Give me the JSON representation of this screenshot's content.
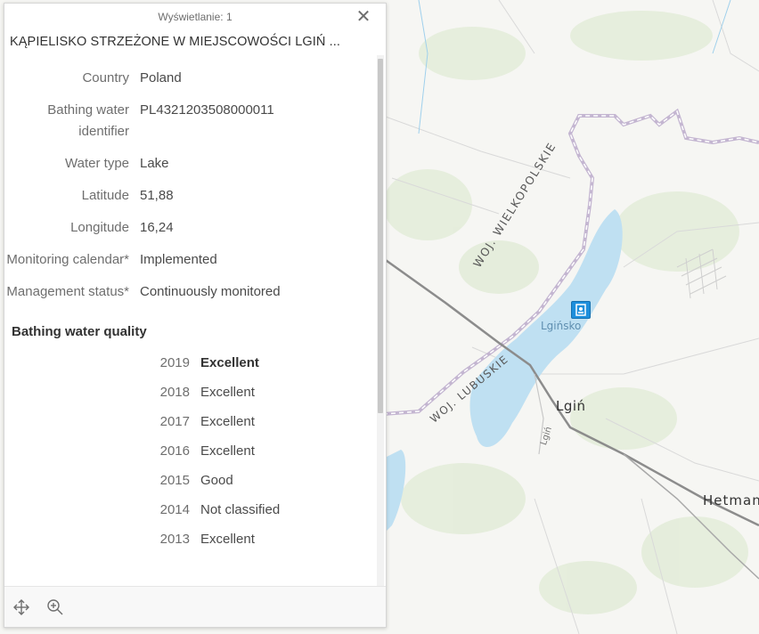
{
  "popup": {
    "header": "Wyświetlanie: 1",
    "title": "KĄPIELISKO STRZEŻONE W MIEJSCOWOŚCI LGIŃ ...",
    "attributes": [
      {
        "label": "Country",
        "value": "Poland"
      },
      {
        "label": "Bathing water identifier",
        "value": "PL4321203508000011"
      },
      {
        "label": "Water type",
        "value": "Lake"
      },
      {
        "label": "Latitude",
        "value": "51,88"
      },
      {
        "label": "Longitude",
        "value": "16,24"
      },
      {
        "label": "Monitoring calendar*",
        "value": "Implemented"
      },
      {
        "label": "Management status*",
        "value": "Continuously monitored"
      }
    ],
    "quality_heading": "Bathing water quality",
    "quality": [
      {
        "year": "2019",
        "value": "Excellent"
      },
      {
        "year": "2018",
        "value": "Excellent"
      },
      {
        "year": "2017",
        "value": "Excellent"
      },
      {
        "year": "2016",
        "value": "Excellent"
      },
      {
        "year": "2015",
        "value": "Good"
      },
      {
        "year": "2014",
        "value": "Not classified"
      },
      {
        "year": "2013",
        "value": "Excellent"
      }
    ],
    "footer": {
      "pan_icon": "pan-icon",
      "zoom_icon": "zoom-in-icon"
    },
    "close_icon": "close-icon"
  },
  "map": {
    "labels": {
      "woj_wielkopolskie": "WOJ. WIELKOPOLSKIE",
      "woj_lubuskie": "WOJ. LUBUSKIE",
      "lginsko": "Lgińsko",
      "lgin": "Lgiń",
      "lgin_road": "Lgiń",
      "hetman": "Hetman"
    },
    "marker_icon": "bathing-site-icon",
    "colors": {
      "water": "#bfe0f2",
      "land": "#f6f6f3",
      "vegetation": "#e3ecd9",
      "marker": "#1e8fdc"
    }
  }
}
